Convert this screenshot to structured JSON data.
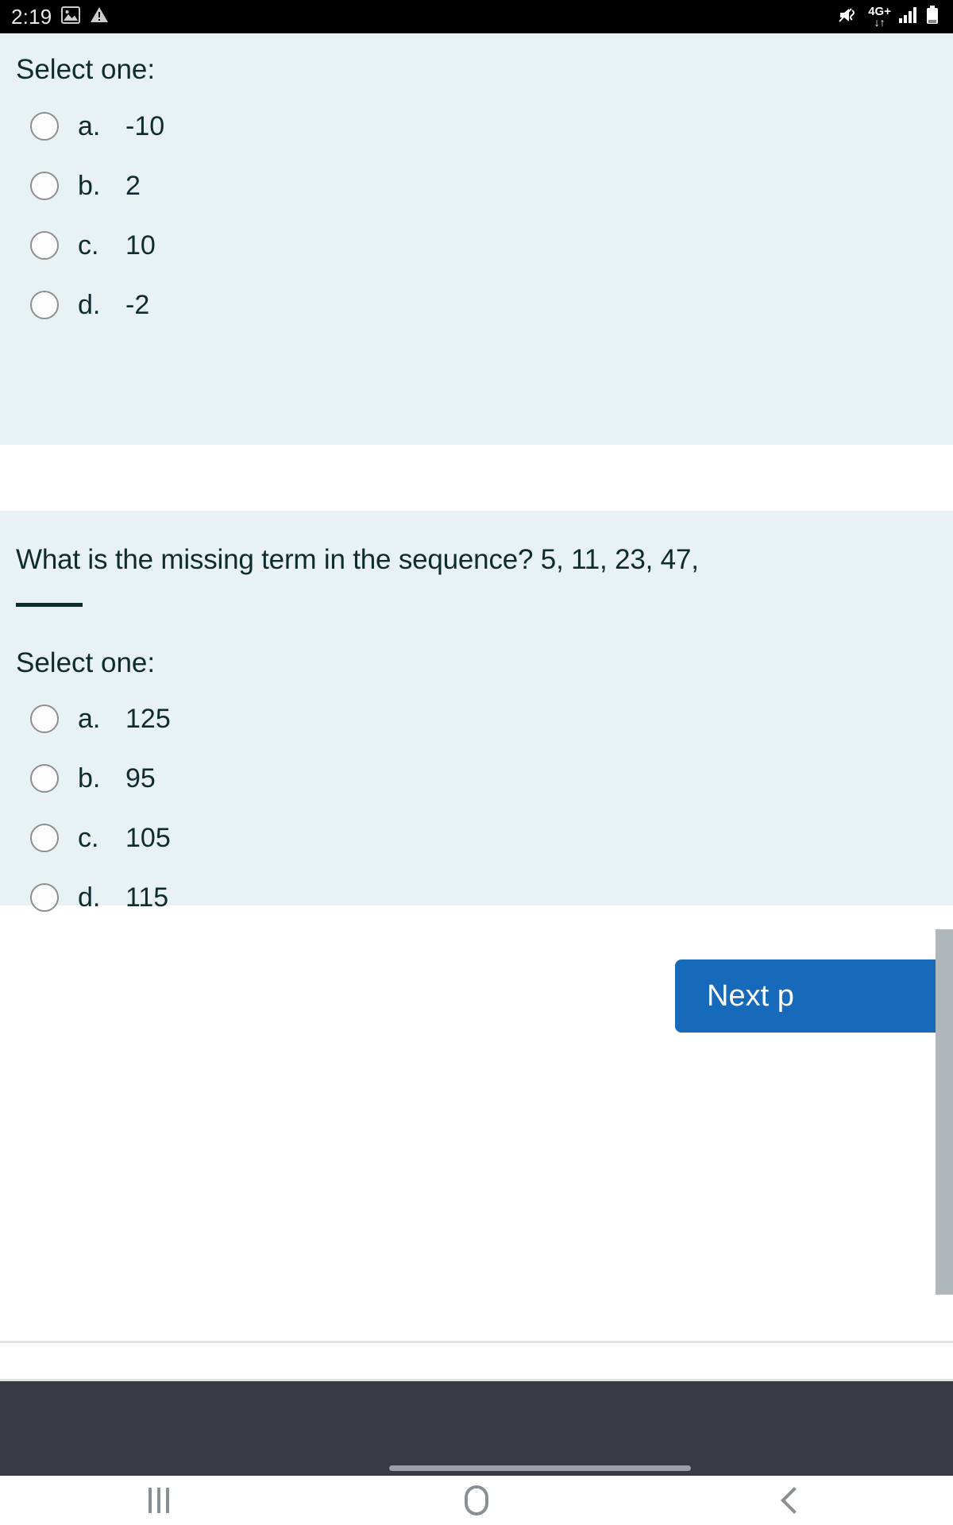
{
  "status_bar": {
    "clock": "2:19",
    "icons_left": [
      "image-icon",
      "warning-triangle-icon"
    ],
    "network_type": "4G+",
    "network_arrows": "↓↑",
    "icons_right": [
      "mute-icon",
      "signal-bars-icon",
      "battery-icon"
    ],
    "background_color": "#000000"
  },
  "theme": {
    "card_background": "#e8f1f3",
    "text_color": "#0e2b2e",
    "accent_color": "#1769ba",
    "footer_color": "#363b45"
  },
  "question_1": {
    "select_label": "Select one:",
    "options": [
      {
        "letter": "a.",
        "value": "-10",
        "selected": false
      },
      {
        "letter": "b.",
        "value": "2",
        "selected": false
      },
      {
        "letter": "c.",
        "value": "10",
        "selected": false
      },
      {
        "letter": "d.",
        "value": "-2",
        "selected": false
      }
    ]
  },
  "question_2": {
    "text_before_blank": "What is the missing term in the sequence? 5, 11, 23, 47,",
    "blank": "_____",
    "select_label": "Select one:",
    "options": [
      {
        "letter": "a.",
        "value": "125",
        "selected": false
      },
      {
        "letter": "b.",
        "value": "95",
        "selected": false
      },
      {
        "letter": "c.",
        "value": "105",
        "selected": false
      },
      {
        "letter": "d.",
        "value": "115",
        "selected": false
      }
    ]
  },
  "actions": {
    "next_label": "Next p"
  },
  "navbar": {
    "recents_label": "recents-icon",
    "home_label": "home-icon",
    "back_label": "back-icon"
  }
}
